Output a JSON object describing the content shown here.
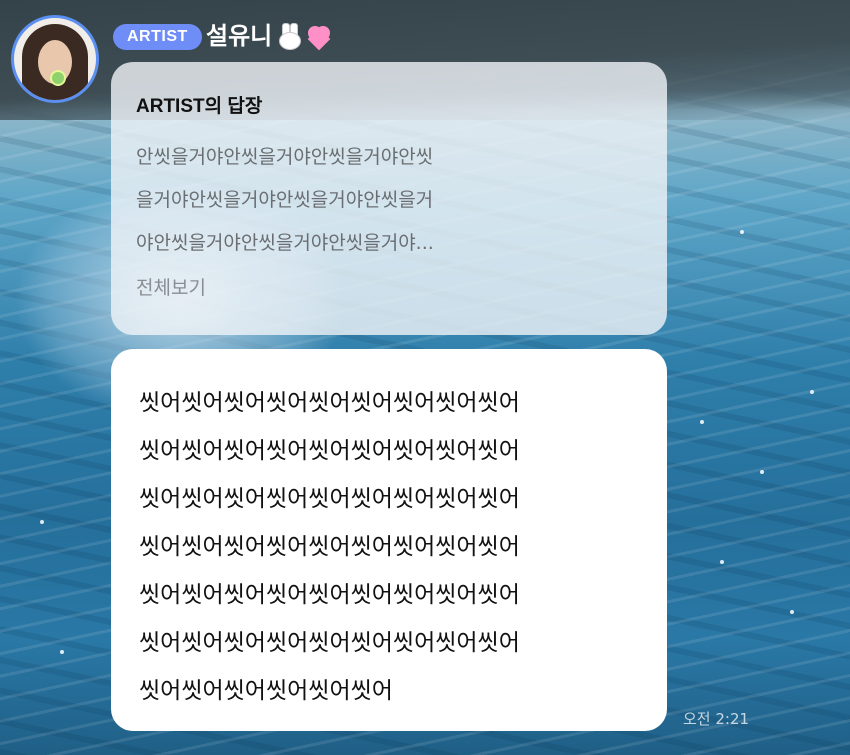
{
  "header": {
    "badge": "ARTIST",
    "name": "설유니",
    "name_icons": [
      "bunny-emoji",
      "pink-heart-emoji"
    ]
  },
  "reply": {
    "title": "ARTIST의 답장",
    "lines": [
      "안씻을거야안씻을거야안씻을거야안씻",
      "을거야안씻을거야안씻을거야안씻을거",
      "야안씻을거야안씻을거야안씻을거야..."
    ],
    "more_label": "전체보기"
  },
  "message": {
    "lines": [
      "씻어씻어씻어씻어씻어씻어씻어씻어씻어",
      "씻어씻어씻어씻어씻어씻어씻어씻어씻어",
      "씻어씻어씻어씻어씻어씻어씻어씻어씻어",
      "씻어씻어씻어씻어씻어씻어씻어씻어씻어",
      "씻어씻어씻어씻어씻어씻어씻어씻어씻어",
      "씻어씻어씻어씻어씻어씻어씻어씻어씻어",
      "씻어씻어씻어씻어씻어씻어"
    ],
    "timestamp": "오전 2:21"
  },
  "colors": {
    "badge_bg": "#6f8df6",
    "avatar_ring": "#5b8ff0",
    "reply_text": "#6a6e72",
    "message_text": "#111111"
  }
}
